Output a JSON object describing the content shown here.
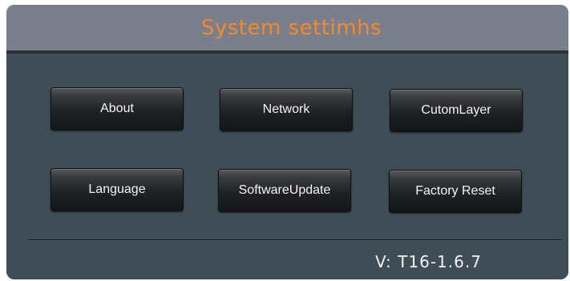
{
  "window": {
    "title": "System settimhs"
  },
  "buttons": {
    "about": "About",
    "network": "Network",
    "custom_layer": "CutomLayer",
    "language": "Language",
    "software_update": "SoftwareUpdate",
    "factory_reset": "Factory Reset"
  },
  "footer": {
    "version": "V:  T16-1.6.7"
  },
  "colors": {
    "title_text": "#f28a2a",
    "titlebar_bg": "#7a7f8b",
    "panel_bg": "#3f4e56",
    "button_bg": "#1f2123",
    "button_text": "#f4f4f4"
  }
}
